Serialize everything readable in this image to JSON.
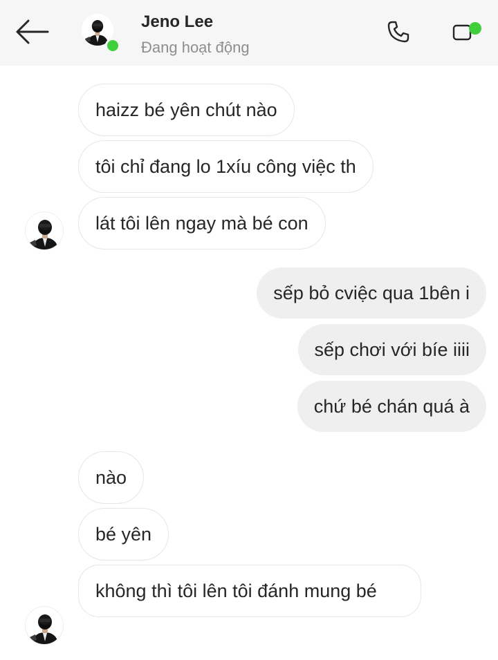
{
  "header": {
    "contact_name": "Jeno Lee",
    "contact_status": "Đang hoạt động",
    "back_icon": "arrow-left-icon",
    "call_icon": "phone-icon",
    "video_icon": "video-camera-icon",
    "online_color": "#3fcf3a"
  },
  "messages": [
    {
      "side": "in",
      "text": "haizz bé yên chút nào"
    },
    {
      "side": "in",
      "text": "tôi chỉ đang lo 1xíu công việc th"
    },
    {
      "side": "in",
      "text": "lát tôi lên ngay mà bé con"
    },
    {
      "side": "out",
      "text": "sếp bỏ cviệc qua 1bên i"
    },
    {
      "side": "out",
      "text": "sếp chơi với bíe iiii"
    },
    {
      "side": "out",
      "text": "chứ bé chán quá à"
    },
    {
      "side": "in",
      "text": "nào"
    },
    {
      "side": "in",
      "text": "bé yên"
    },
    {
      "side": "in",
      "text": "không thì tôi lên tôi đánh mung bé"
    }
  ],
  "colors": {
    "incoming_bubble": "#ffffff",
    "outgoing_bubble": "#efefef",
    "header_bg": "#f6f6f6"
  }
}
